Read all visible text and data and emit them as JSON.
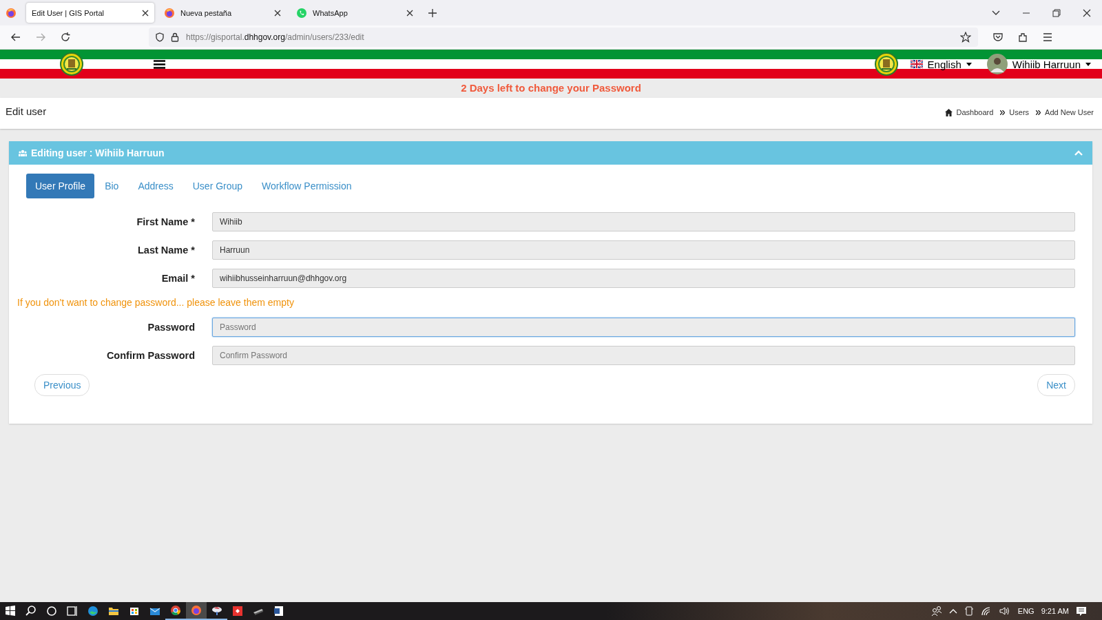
{
  "browser": {
    "tabs": [
      {
        "title": "Edit User | GIS Portal",
        "kind": "plain",
        "selected": true
      },
      {
        "title": "Nueva pestaña",
        "kind": "browser",
        "selected": false
      },
      {
        "title": "WhatsApp",
        "kind": "chat",
        "selected": false
      }
    ],
    "address": "https://gisportal.**dhhgov.org**/admin/users/233/edit"
  },
  "header": {
    "language": "English",
    "user": "Wihiib Harruun"
  },
  "notice": "2 Days left to change your Password",
  "page": {
    "title": "Edit user",
    "breadcrumb": [
      "Dashboard",
      "Users",
      "Add New User"
    ]
  },
  "panel": {
    "title": "Editing user : Wihiib Harruun",
    "expanded": true,
    "tabs": [
      {
        "label": "User Profile",
        "selected": true
      },
      {
        "label": "Bio",
        "selected": false
      },
      {
        "label": "Address",
        "selected": false
      },
      {
        "label": "User Group",
        "selected": false
      },
      {
        "label": "Workflow Permission",
        "selected": false
      }
    ],
    "fields": [
      {
        "kind": "field",
        "label": "First Name *",
        "value": "Wihiib",
        "focused": false
      },
      {
        "kind": "field",
        "label": "Last Name *",
        "value": "Harruun",
        "focused": false
      },
      {
        "kind": "field",
        "label": "Email *",
        "value": "wihiibhusseinharruun@dhhgov.org",
        "focused": false
      },
      {
        "kind": "note",
        "text": "If you don't want to change password... please leave them empty"
      },
      {
        "kind": "field",
        "label": "Password",
        "placeholder": "Password",
        "focused": true
      },
      {
        "kind": "field",
        "label": "Confirm Password",
        "placeholder": "Confirm Password",
        "focused": false
      }
    ],
    "buttons": [
      "Previous",
      "Next"
    ]
  },
  "taskbar": {
    "apps": [
      {
        "kind": "start",
        "running": false,
        "active": false
      },
      {
        "kind": "search",
        "running": false,
        "active": false
      },
      {
        "kind": "cortana",
        "running": false,
        "active": false
      },
      {
        "kind": "taskview",
        "running": false,
        "active": false
      },
      {
        "kind": "edge",
        "running": false,
        "active": false
      },
      {
        "kind": "folder",
        "running": false,
        "active": false
      },
      {
        "kind": "store",
        "running": false,
        "active": false
      },
      {
        "kind": "mail",
        "running": false,
        "active": false
      },
      {
        "kind": "chrome",
        "running": true,
        "active": false
      },
      {
        "kind": "firefox",
        "running": true,
        "active": true
      },
      {
        "kind": "bird",
        "running": true,
        "active": false
      },
      {
        "kind": "redapp",
        "running": false,
        "active": false
      },
      {
        "kind": "scanner",
        "running": false,
        "active": false
      },
      {
        "kind": "word",
        "running": false,
        "active": false
      }
    ],
    "language": "ENG",
    "time": "9:21 AM"
  }
}
